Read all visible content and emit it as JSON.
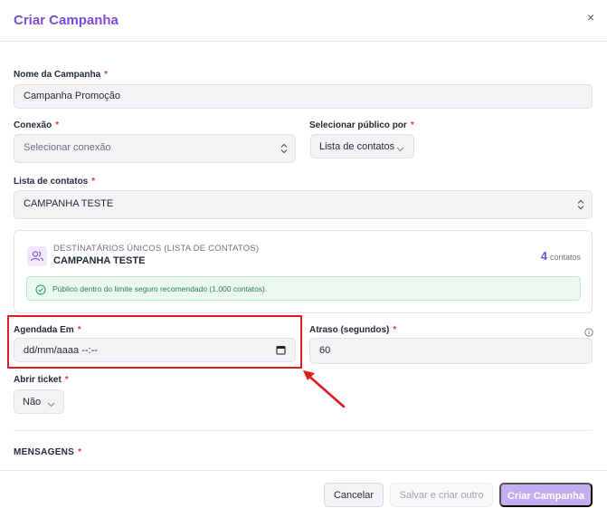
{
  "dialog": {
    "title": "Criar Campanha",
    "close_symbol": "×"
  },
  "required_mark": "*",
  "fields": {
    "campaign_name": {
      "label": "Nome da Campanha",
      "value": "Campanha Promoção"
    },
    "connection": {
      "label": "Conexão",
      "placeholder": "Selecionar conexão"
    },
    "audience": {
      "label": "Selecionar público por",
      "value": "Lista de contatos"
    },
    "contact_list": {
      "label": "Lista de contatos",
      "value": "CAMPANHA TESTE"
    },
    "scheduled_at": {
      "label": "Agendada Em",
      "value": "dd/mm/aaaa --:--"
    },
    "delay": {
      "label": "Atraso (segundos)",
      "value": "60"
    },
    "open_ticket": {
      "label": "Abrir ticket",
      "value": "Não"
    }
  },
  "recipients_card": {
    "subtitle": "DESTINATÁRIOS ÚNICOS (LISTA DE CONTATOS)",
    "name": "CAMPANHA TESTE",
    "count": "4",
    "count_label": "contatos",
    "notice": "Público dentro do limite seguro recomendado (1.000 contatos)."
  },
  "messages_section": {
    "title": "MENSAGENS"
  },
  "footer": {
    "cancel_label": "Cancelar",
    "save_other_label": "Salvar e criar outro",
    "create_label": "Criar Campanha"
  },
  "colors": {
    "accent": "#7c4ddb",
    "required": "#e03e3e",
    "highlight": "#e01b1b",
    "success_bg": "#eaf8ef",
    "success_text": "#2f7d4f"
  },
  "icons": {
    "close": "close-icon",
    "select": "chevron-up-down-icon",
    "dropdown": "chevron-down-icon",
    "users": "users-icon",
    "success": "check-circle-icon",
    "calendar": "calendar-icon",
    "info": "info-icon"
  }
}
